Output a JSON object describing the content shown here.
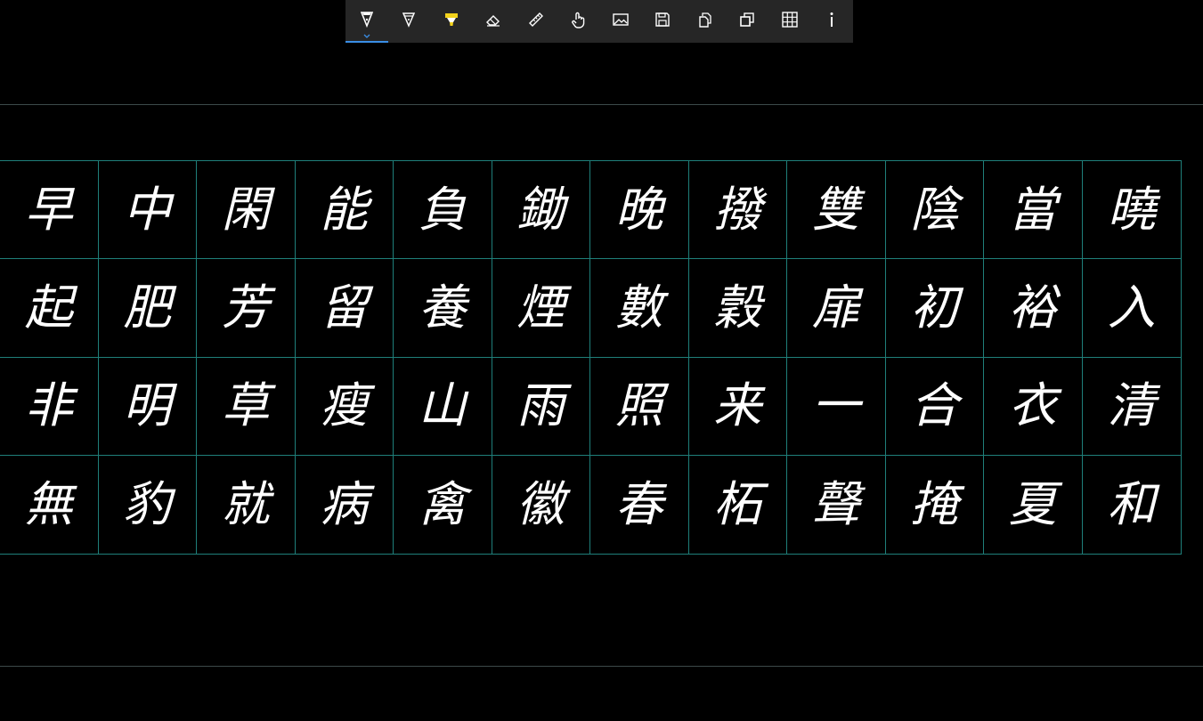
{
  "toolbar": {
    "tools": [
      {
        "name": "pen-icon",
        "active": true
      },
      {
        "name": "pencil-icon",
        "active": false
      },
      {
        "name": "highlighter-icon",
        "active": false
      },
      {
        "name": "eraser-icon",
        "active": false
      },
      {
        "name": "ruler-icon",
        "active": false
      },
      {
        "name": "touch-icon",
        "active": false
      },
      {
        "name": "image-icon",
        "active": false
      },
      {
        "name": "save-icon",
        "active": false
      },
      {
        "name": "copy-icon",
        "active": false
      },
      {
        "name": "duplicate-icon",
        "active": false
      },
      {
        "name": "grid-icon",
        "active": false
      },
      {
        "name": "info-icon",
        "active": false
      }
    ],
    "colors": {
      "background": "#262626",
      "accent": "#3a8ee6",
      "highlighter": "#f2d21b",
      "icon": "#ffffff"
    }
  },
  "practice_grid": {
    "line_color": "#1f7f7a",
    "rows": [
      [
        "早",
        "中",
        "閑",
        "能",
        "負",
        "鋤",
        "晚",
        "撥",
        "雙",
        "陰",
        "當",
        "曉"
      ],
      [
        "起",
        "肥",
        "芳",
        "留",
        "養",
        "煙",
        "數",
        "穀",
        "扉",
        "初",
        "裕",
        "入"
      ],
      [
        "非",
        "明",
        "草",
        "瘦",
        "山",
        "雨",
        "照",
        "来",
        "一",
        "合",
        "衣",
        "清"
      ],
      [
        "無",
        "豹",
        "就",
        "病",
        "禽",
        "徽",
        "春",
        "柘",
        "聲",
        "掩",
        "夏",
        "和"
      ]
    ]
  }
}
